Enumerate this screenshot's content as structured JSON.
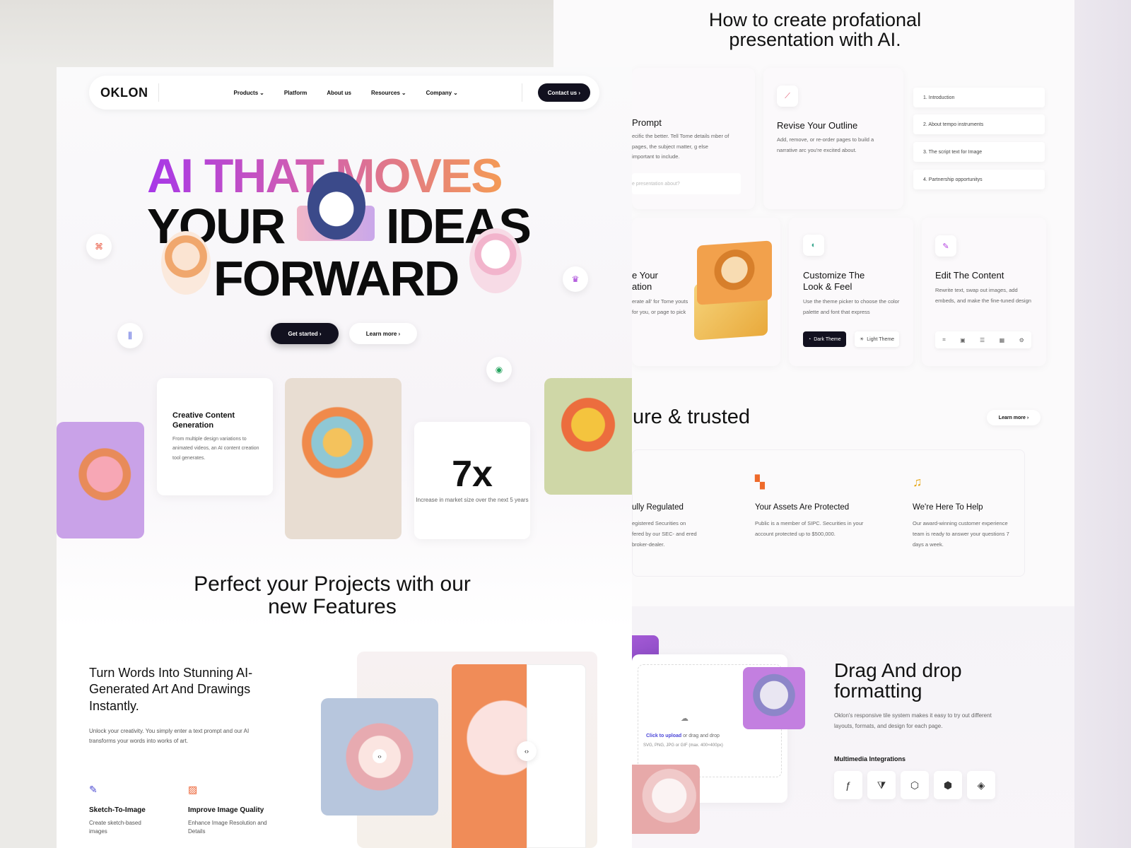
{
  "nav": {
    "logo": "OKLON",
    "links": [
      "Products",
      "Platform",
      "About us",
      "Resources",
      "Company"
    ],
    "contact": "Contact us ›"
  },
  "hero": {
    "line1": "AI THAT MOVES",
    "line2a": "YOUR",
    "line2b": "IDEAS",
    "line3": "FORWARD",
    "cta_primary": "Get started ›",
    "cta_secondary": "Learn more ›"
  },
  "cards": {
    "creative_title": "Creative Content Generation",
    "creative_text": "From multiple design variations to animated videos, an AI content creation tool generates.",
    "stat_value": "7x",
    "stat_text": "Increase in market size over the next 5 years"
  },
  "features": {
    "heading": "Perfect your Projects with our new Features",
    "title": "Turn Words Into Stunning AI-Generated Art And Drawings Instantly.",
    "text": "Unlock your creativity. You simply enter a text prompt and our AI transforms your words into works of art.",
    "items": [
      {
        "title": "Sketch-To-Image",
        "text": "Create sketch-based images"
      },
      {
        "title": "Improve Image Quality",
        "text": "Enhance Image Resolution and Details"
      }
    ]
  },
  "right": {
    "title": "How to create profational presentation with AI.",
    "prompt": {
      "title": "Prompt",
      "text": "ecific the better. Tell Tome details mber of pages, the subject matter, g else important to include.",
      "placeholder": "e presentation about?"
    },
    "outline": {
      "title": "Revise Your Outline",
      "text": "Add, remove, or re-order pages to build a narrative arc you're excited about.",
      "items": [
        "1. Introduction",
        "2. About tempo instruments",
        "3. The script text for Image",
        "4. Partnership opportunitys"
      ]
    },
    "layout": {
      "title": "e Your ation",
      "text": "erate all' for Tome youts for you, or page to pick"
    },
    "customize": {
      "title": "Customize The Look & Feel",
      "text": "Use the theme picker to choose the color palette and font that express",
      "dark": "Dark Theme",
      "light": "Light Theme"
    },
    "edit": {
      "title": "Edit The Content",
      "text": "Rewrite text, swap out images, add embeds, and make the fine-tuned design"
    },
    "secure": {
      "heading": "ure & trusted",
      "learn": "Learn more ›",
      "items": [
        {
          "title": "ully Regulated",
          "text": "egistered Securities on fered by our SEC- and ered broker-dealer."
        },
        {
          "title": "Your Assets Are Protected",
          "text": "Public is a member of SIPC. Securities in your account protected up to $500,000."
        },
        {
          "title": "We're Here To Help",
          "text": "Our award-winning customer experience team is ready to answer your questions 7 days a week."
        }
      ]
    },
    "dragdrop": {
      "title": "Drag And drop formatting",
      "text": "Oklon's responsive tile system makes it easy to try out different layouts, formats, and design for each page.",
      "integrations_label": "Multimedia Integrations",
      "upload_link": "Click to upload",
      "upload_rest": " or drag and drop",
      "upload_formats": "SVG, PNG, JPG or GIF (max. 400×400px)"
    }
  },
  "colors": {
    "accent_dark": "#12111f",
    "gradient_start": "#a737e8",
    "gradient_end": "#f49a55",
    "link_blue": "#4a45d8"
  }
}
